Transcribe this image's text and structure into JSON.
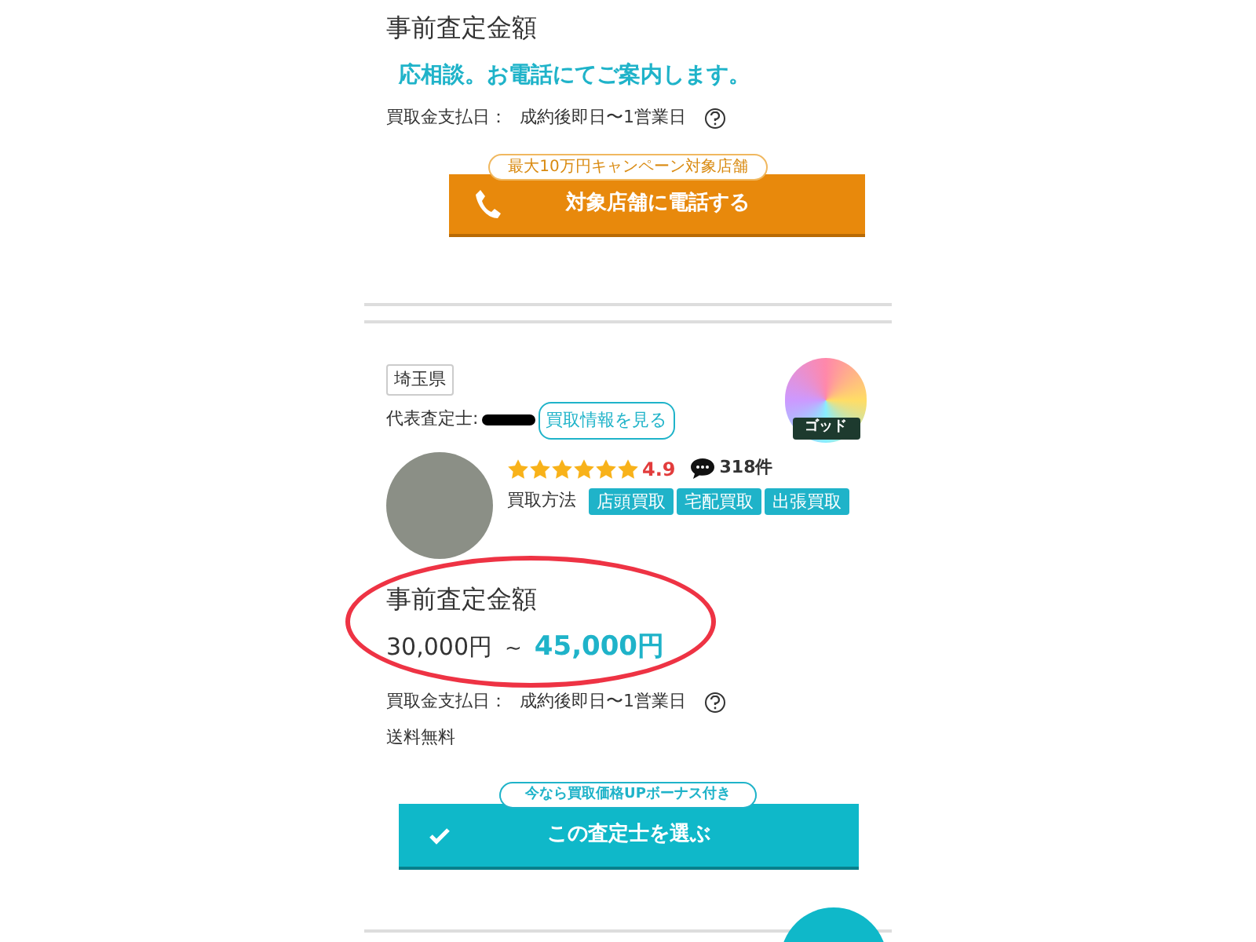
{
  "top_offer": {
    "heading": "事前査定金額",
    "notice": "応相談。お電話にてご案内します。",
    "payment_label": "買取金支払日：",
    "payment_value": "成約後即日〜1営業日",
    "badge": "最大10万円キャンペーン対象店舗",
    "button": "対象店舗に電話する"
  },
  "card": {
    "prefecture": "埼玉県",
    "appraiser_label": "代表査定士:",
    "info_button": "買取情報を見る",
    "rank_badge": "ゴッド",
    "stars": 6,
    "rating": "4.9",
    "review_count": "318件",
    "methods_label": "買取方法",
    "methods": [
      "店頭買取",
      "宅配買取",
      "出張買取"
    ],
    "price_heading": "事前査定金額",
    "price_min": "30,000円",
    "price_sep": "~",
    "price_max": "45,000円",
    "highlighted": true,
    "payment_label": "買取金支払日：",
    "payment_value": "成約後即日〜1営業日",
    "shipping": "送料無料",
    "badge": "今なら買取価格UPボーナス付き",
    "button": "この査定士を選ぶ"
  }
}
